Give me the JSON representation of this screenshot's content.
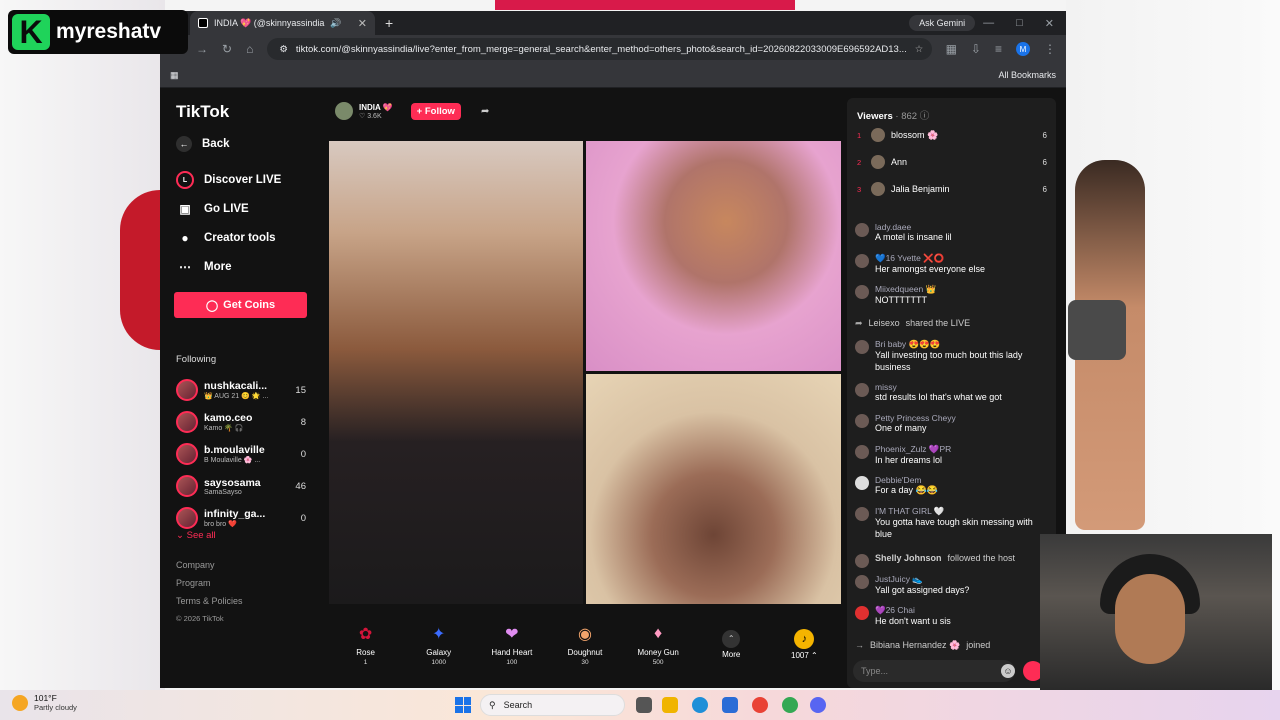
{
  "watermark": {
    "letter": "K",
    "name": "myreshatv"
  },
  "browser": {
    "tab_title": "INDIA 💖 (@skinnyassindia",
    "new_tab": "+",
    "gemini": "Ask Gemini",
    "url": "tiktok.com/@skinnyassindia/live?enter_from_merge=general_search&enter_method=others_photo&search_id=20260822033009E696592AD13...",
    "bookmarks": "All Bookmarks",
    "profile_letter": "M"
  },
  "sidebar": {
    "logo": "TikTok",
    "back": "Back",
    "nav": [
      {
        "label": "Discover LIVE",
        "icon": "live-icon"
      },
      {
        "label": "Go LIVE",
        "icon": "camera-icon"
      },
      {
        "label": "Creator tools",
        "icon": "bulb-icon"
      },
      {
        "label": "More",
        "icon": "more-icon"
      }
    ],
    "coins_label": "Get Coins",
    "following_header": "Following",
    "following": [
      {
        "name": "nushkacali...",
        "sub": "👑 AUG 21 😊 🌟 ...",
        "count": "15"
      },
      {
        "name": "kamo.ceo",
        "sub": "Kamo 🌴 🎧",
        "count": "8"
      },
      {
        "name": "b.moulaville",
        "sub": "B Moulaville 🌸 ...",
        "count": "0"
      },
      {
        "name": "saysosama",
        "sub": "SamaSayso",
        "count": "46"
      },
      {
        "name": "infinity_ga...",
        "sub": "bro bro ❤️",
        "count": "0"
      }
    ],
    "see_all": "See all",
    "footer": [
      "Company",
      "Program",
      "Terms & Policies"
    ],
    "copyright": "© 2026 TikTok"
  },
  "live": {
    "host_name": "INDIA 💖",
    "host_likes": "♡ 3.6K",
    "follow_label": "+ Follow",
    "gifts": [
      {
        "label": "Rose",
        "cost": "1",
        "icon": "rose-icon",
        "color": "#d4143a"
      },
      {
        "label": "Galaxy",
        "cost": "1000",
        "icon": "galaxy-icon",
        "color": "#3b6cff"
      },
      {
        "label": "Hand Heart",
        "cost": "100",
        "icon": "hand-heart-icon",
        "color": "#e08cf0"
      },
      {
        "label": "Doughnut",
        "cost": "30",
        "icon": "doughnut-icon",
        "color": "#f2a46b"
      },
      {
        "label": "Money Gun",
        "cost": "500",
        "icon": "money-gun-icon",
        "color": "#ff9ac2"
      }
    ],
    "more_label": "More",
    "coin_balance": "1007 ⌃"
  },
  "chat": {
    "viewers_label": "Viewers",
    "viewers_count": "· 862",
    "top_viewers": [
      {
        "rank": "1",
        "name": "blossom 🌸",
        "score": "6"
      },
      {
        "rank": "2",
        "name": "Ann",
        "score": "6"
      },
      {
        "rank": "3",
        "name": "Jalia Benjamin",
        "score": "6"
      }
    ],
    "messages": [
      {
        "user": "lady.daee",
        "text": "A motel is insane lil"
      },
      {
        "user": "💙16 Yvette ❌⭕",
        "text": "Her amongst everyone else"
      },
      {
        "user": "Miixedqueen 👑",
        "text": "NOTTTTTTT"
      },
      {
        "user": "Leisexo",
        "text": "shared the LIVE"
      },
      {
        "user": "Bri baby 😍😍😍",
        "text": "Yall investing too much bout this lady business"
      },
      {
        "user": "missy",
        "text": "std results lol that's what we got"
      },
      {
        "user": "Petty Princess Cheyy",
        "text": "One of many"
      },
      {
        "user": "Phoenix_Zulz 💜PR",
        "text": "In her dreams lol"
      },
      {
        "user": "Debbie'Dem",
        "text": "For a day 😂😂"
      },
      {
        "user": "I'M THAT GIRL 🤍",
        "text": "You gotta have tough skin messing with blue"
      },
      {
        "user": "Shelly Johnson",
        "text": "followed the host"
      },
      {
        "user": "JustJuicy 👟",
        "text": "Yall got assigned days?"
      },
      {
        "user": "💜26 Chai",
        "text": "He don't want u sis"
      },
      {
        "user": "Bibiana Hernandez 🌸",
        "text": "joined"
      }
    ],
    "input_placeholder": "Type..."
  },
  "taskbar": {
    "temp": "101°F",
    "weather": "Partly cloudy",
    "search": "Search"
  }
}
